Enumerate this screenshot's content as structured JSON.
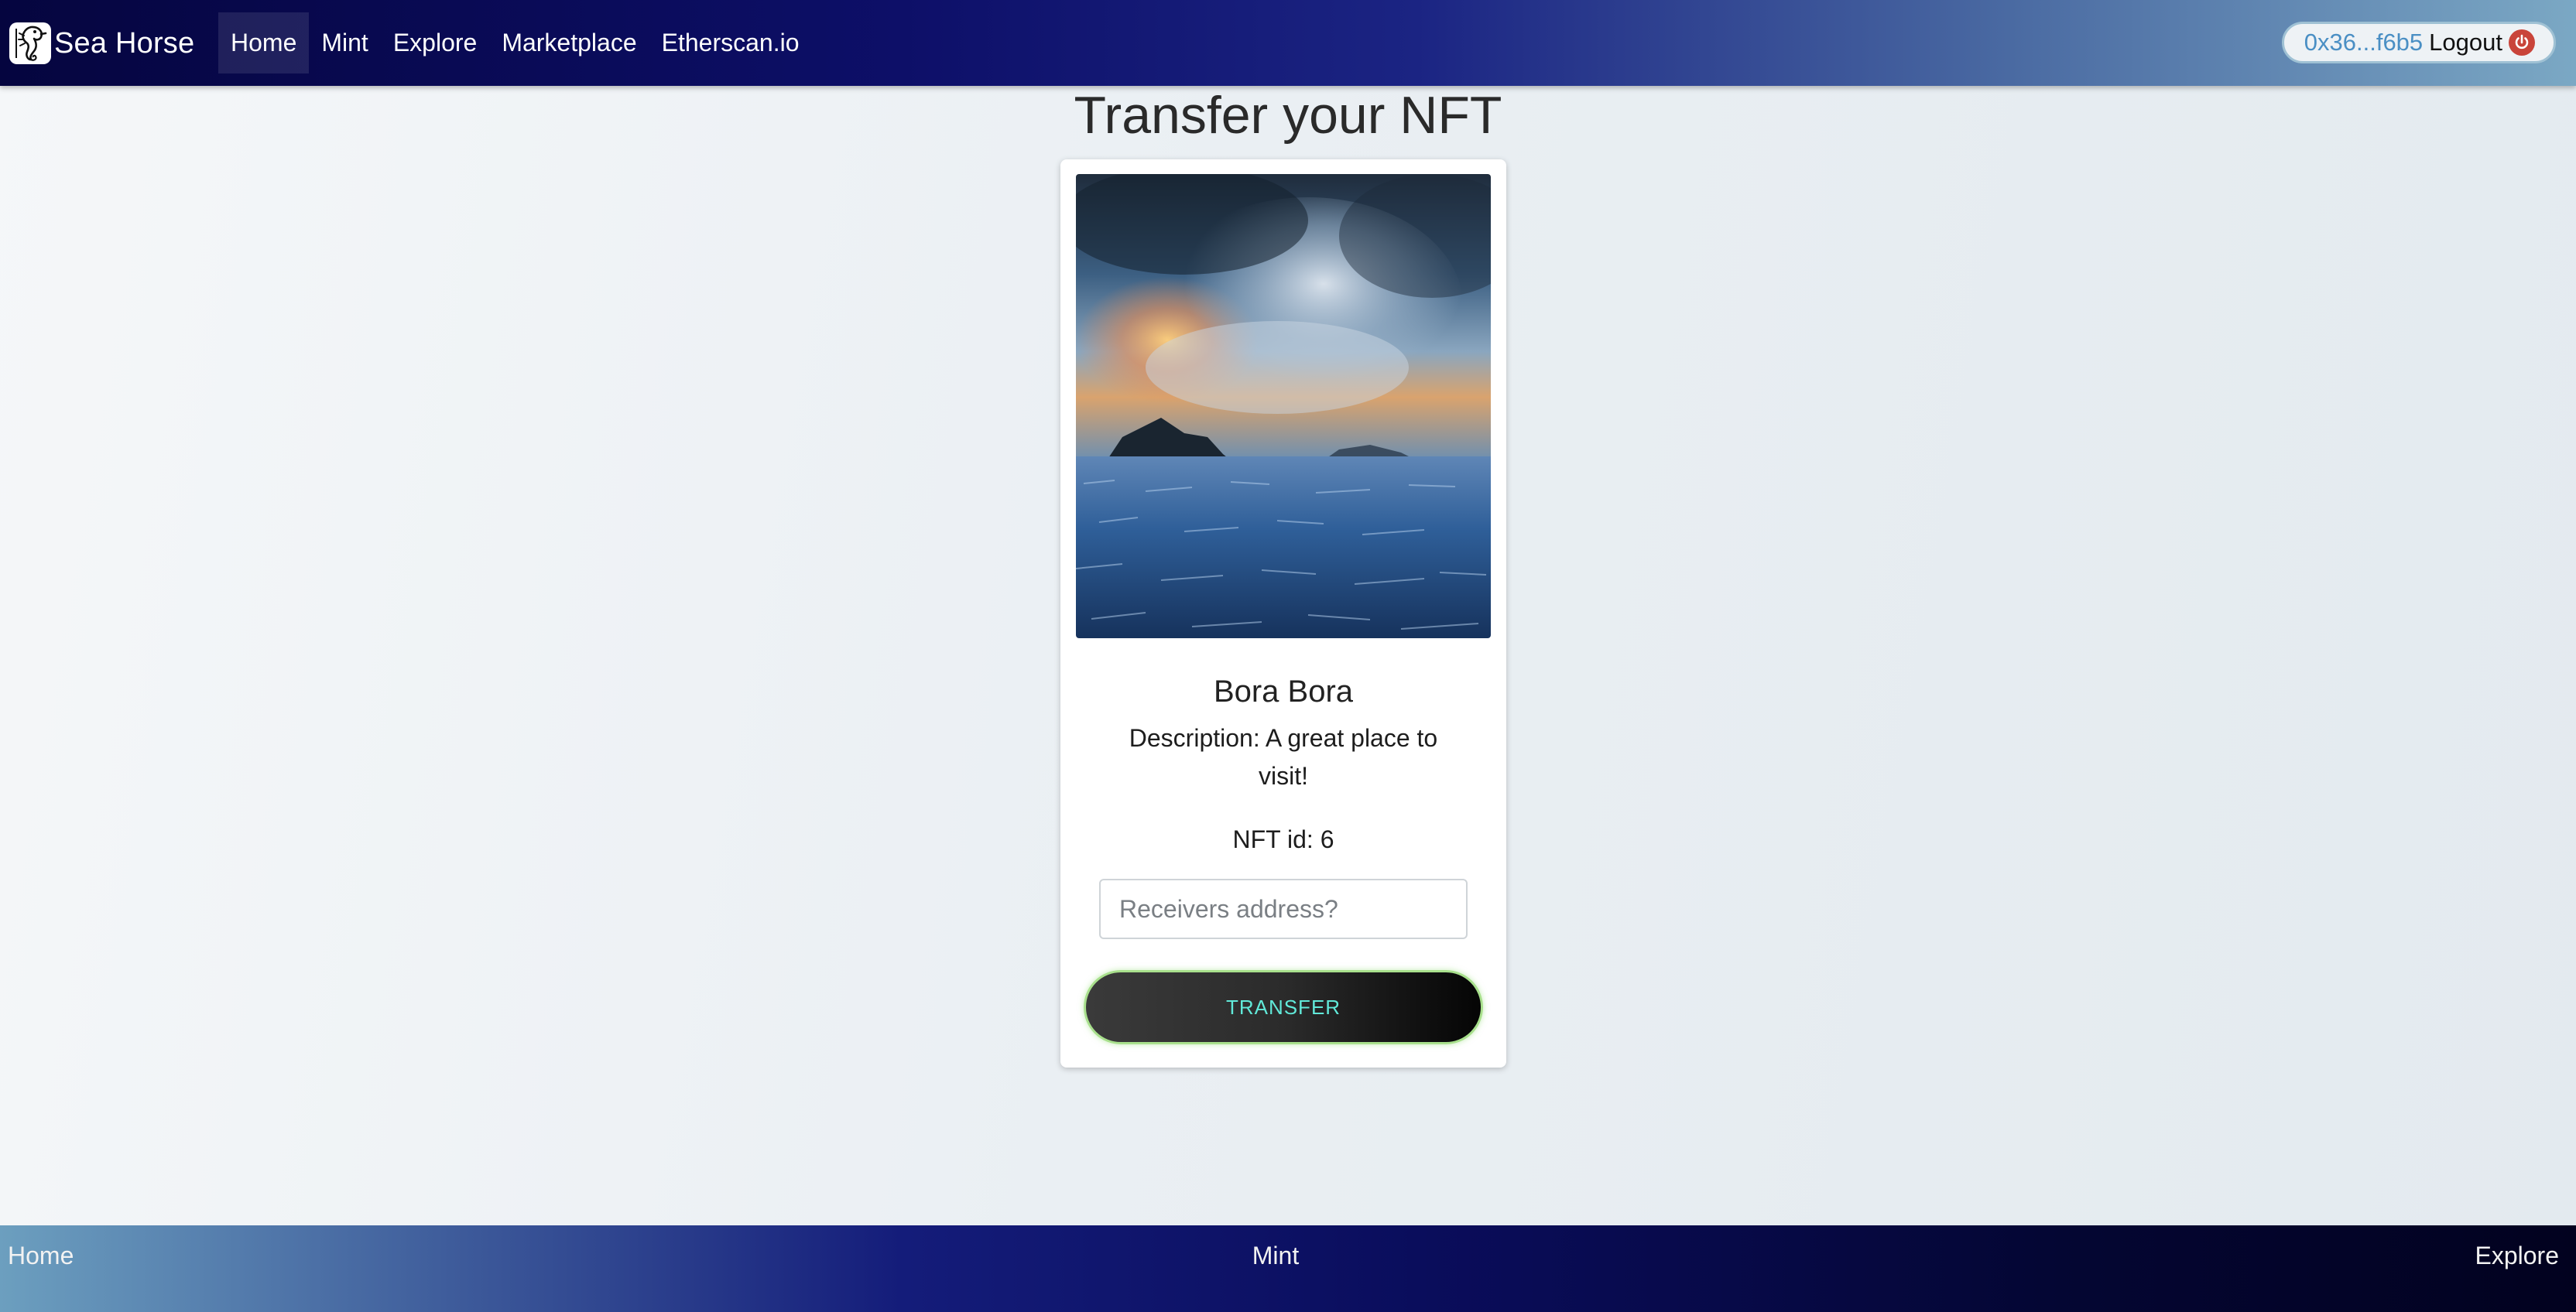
{
  "navbar": {
    "brand": "Sea Horse",
    "brand_icon": "seahorse-icon",
    "links": [
      {
        "label": "Home",
        "active": true
      },
      {
        "label": "Mint",
        "active": false
      },
      {
        "label": "Explore",
        "active": false
      },
      {
        "label": "Marketplace",
        "active": false
      },
      {
        "label": "Etherscan.io",
        "active": false
      }
    ],
    "account": {
      "address": "0x36...f6b5",
      "logout_label": "Logout",
      "logout_icon": "power-icon"
    }
  },
  "page": {
    "title": "Transfer your NFT"
  },
  "nft": {
    "image_description_icon": "ocean-sunset-image",
    "name": "Bora Bora",
    "description": "Description: A great place to visit!",
    "id_text": "NFT id: 6",
    "receiver_placeholder": "Receivers address?",
    "transfer_label": "TRANSFER"
  },
  "footer": {
    "links": [
      "Home",
      "Mint",
      "Explore"
    ]
  },
  "colors": {
    "address_blue": "#4a8fc4",
    "transfer_text": "#61e9d9",
    "power_red": "#c9443a",
    "navbar_dark": "#05053f"
  }
}
